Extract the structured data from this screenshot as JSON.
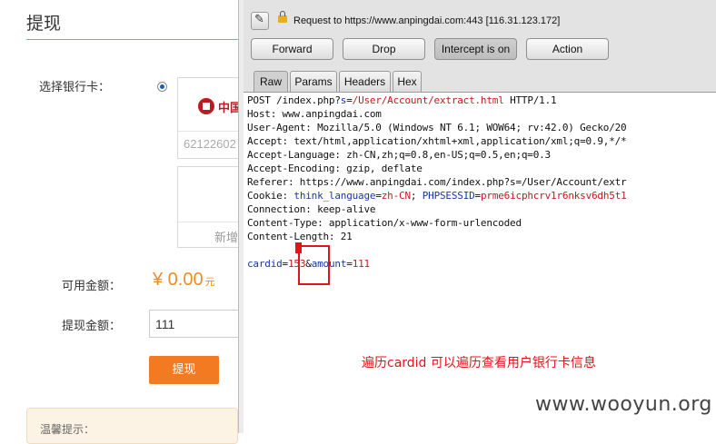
{
  "page": {
    "title": "提现",
    "select_card_label": "选择银行卡：",
    "bank_name": "中国",
    "card_number": "62122602",
    "add_card_label": "新增",
    "available_label": "可用金额：",
    "available_amount": "¥ 0.00",
    "available_unit": "元",
    "withdraw_label": "提现金额：",
    "withdraw_value": "111",
    "withdraw_button": "提现",
    "tip_title": "温馨提示：",
    "accent_color": "#f47a21"
  },
  "burp": {
    "edit_icon": "pencil-icon",
    "request_line": "Request to https://www.anpingdai.com:443  [116.31.123.172]",
    "buttons": [
      "Forward",
      "Drop",
      "Intercept is on",
      "Action"
    ],
    "tabs": [
      "Raw",
      "Params",
      "Headers",
      "Hex"
    ],
    "active_tab": "Raw",
    "request": {
      "line1_method": "POST /index.php?",
      "line1_key": "s",
      "line1_eq": "=",
      "line1_val": "/User/Account/extract.html",
      "line1_tail": " HTTP/1.1",
      "host": "Host: www.anpingdai.com",
      "ua": "User-Agent: Mozilla/5.0 (Windows NT 6.1; WOW64; rv:42.0) Gecko/20",
      "accept": "Accept: text/html,application/xhtml+xml,application/xml;q=0.9,*/*",
      "accept_lang": "Accept-Language: zh-CN,zh;q=0.8,en-US;q=0.5,en;q=0.3",
      "accept_enc": "Accept-Encoding: gzip, deflate",
      "referer": "Referer: https://www.anpingdai.com/index.php?s=/User/Account/extr",
      "cookie_prefix": "Cookie: ",
      "cookie_k1": "think_language",
      "cookie_v1": "zh-CN",
      "cookie_sep": "; ",
      "cookie_k2": "PHPSESSID",
      "cookie_v2": "prme6icphcrv1r6nksv6dh5t1",
      "connection": "Connection: keep-alive",
      "content_type": "Content-Type: application/x-www-form-urlencoded",
      "content_length": "Content-Length: 21",
      "body_k1": "cardid",
      "body_v1": "153",
      "body_amp": "&",
      "body_k2": "amount",
      "body_v2": "111"
    },
    "annotation": "遍历cardid 可以遍历查看用户银行卡信息",
    "watermark": "www.wooyun.org"
  }
}
